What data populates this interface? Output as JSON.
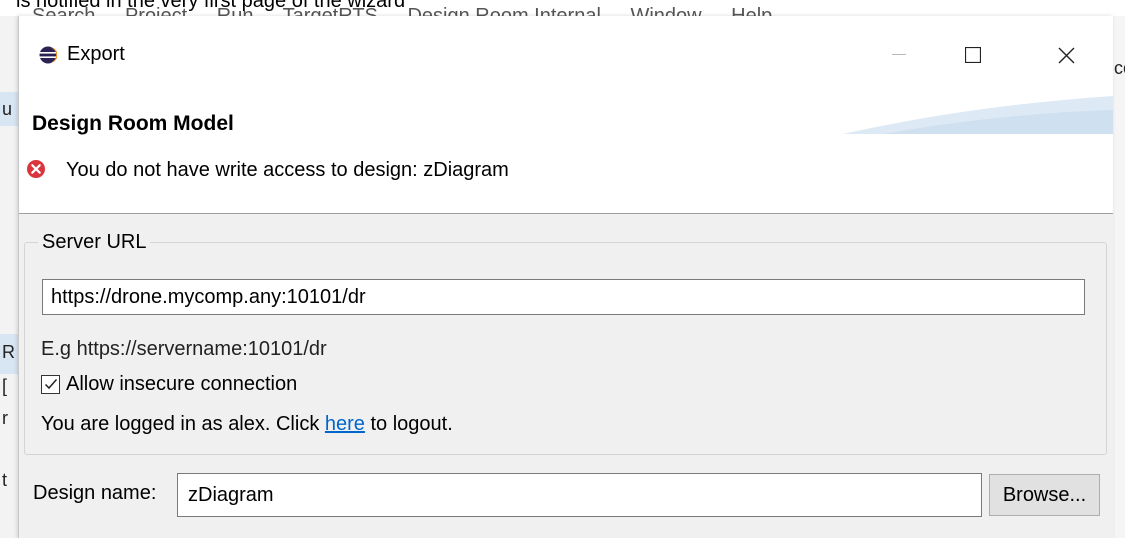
{
  "background": {
    "caption": "is notified in the very first page of the wizard",
    "menu_items": [
      "Search",
      "Project",
      "Run",
      "TargetRTS",
      "Design Room Internal",
      "Window",
      "Help"
    ],
    "left_fragments": [
      "u",
      "R",
      "[",
      "r",
      "t"
    ],
    "right_fragment": "cc"
  },
  "window": {
    "title": "Export",
    "controls": {
      "minimize": "—",
      "maximize": "☐",
      "close": "✕"
    }
  },
  "header": {
    "title": "Design Room Model",
    "message": "You do not have write access to design: zDiagram",
    "status_color": "#d9363e"
  },
  "server_group": {
    "legend": "Server URL",
    "url_value": "https://drone.mycomp.any:10101/dr",
    "hint": "E.g https://servername:10101/dr",
    "insecure_checkbox": {
      "label": "Allow insecure connection",
      "checked": true
    },
    "login_prefix": "You are logged in as alex. Click ",
    "login_link": "here",
    "login_suffix": " to logout."
  },
  "design": {
    "label": "Design name:",
    "value": "zDiagram",
    "browse_label": "Browse..."
  },
  "colors": {
    "dialog_bg": "#f0f0f0",
    "link": "#0066cc",
    "accent_swoosh": "#cfe0f1"
  }
}
